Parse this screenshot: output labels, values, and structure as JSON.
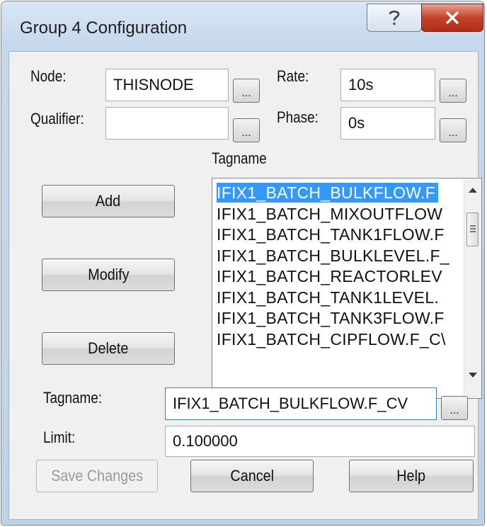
{
  "window": {
    "title": "Group 4 Configuration",
    "help_icon": "question-mark",
    "close_icon": "x"
  },
  "labels": {
    "node": "Node:",
    "qualifier": "Qualifier:",
    "rate": "Rate:",
    "phase": "Phase:",
    "tagname_list_header": "Tagname",
    "tagname": "Tagname:",
    "limit": "Limit:"
  },
  "fields": {
    "node": "THISNODE",
    "qualifier": "",
    "rate": "10s",
    "phase": "0s",
    "tagname": "IFIX1_BATCH_BULKFLOW.F_CV",
    "limit": "0.100000"
  },
  "browse_label": "...",
  "buttons": {
    "add": "Add",
    "modify": "Modify",
    "delete": "Delete",
    "save_changes": "Save Changes",
    "cancel": "Cancel",
    "help": "Help"
  },
  "tag_list": {
    "selected_index": 0,
    "items": [
      "IFIX1_BATCH_BULKFLOW.F",
      "IFIX1_BATCH_MIXOUTFLOW",
      "IFIX1_BATCH_TANK1FLOW.F",
      "IFIX1_BATCH_BULKLEVEL.F_",
      "IFIX1_BATCH_REACTORLEV",
      "IFIX1_BATCH_TANK1LEVEL.",
      "IFIX1_BATCH_TANK3FLOW.F",
      "IFIX1_BATCH_CIPFLOW.F_C\\"
    ]
  },
  "colors": {
    "selection": "#3399ff",
    "close_button": "#c5412b"
  }
}
